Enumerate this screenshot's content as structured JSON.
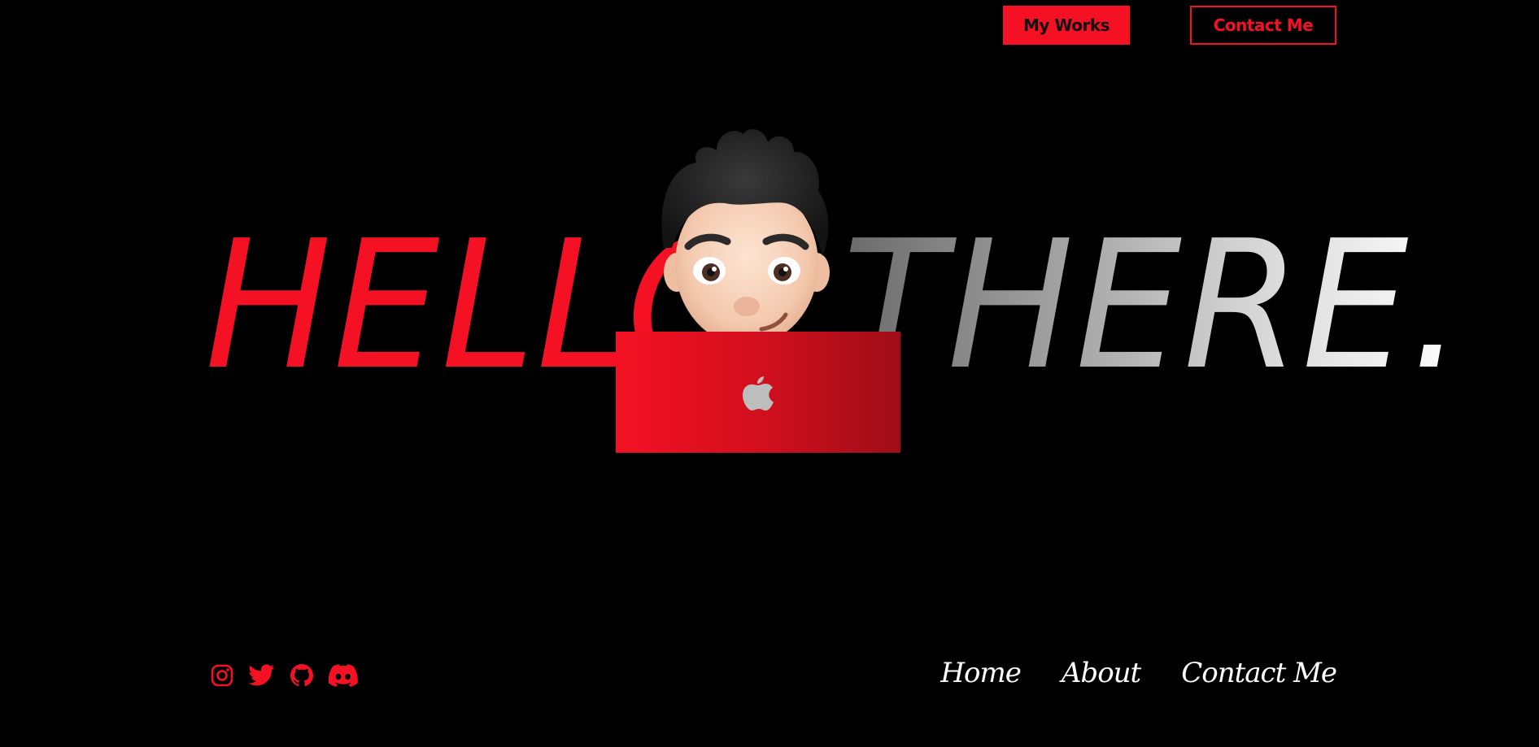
{
  "header": {
    "my_works_label": "My Works",
    "contact_label": "Contact Me"
  },
  "hero": {
    "word_left": "HELLO",
    "word_right": "THERE."
  },
  "laptop": {
    "logo_icon": "apple-logo-icon"
  },
  "social": {
    "icons": [
      "instagram-icon",
      "twitter-icon",
      "github-icon",
      "discord-icon"
    ]
  },
  "nav": {
    "items": [
      {
        "label": "Home"
      },
      {
        "label": "About"
      },
      {
        "label": "Contact Me"
      }
    ]
  },
  "colors": {
    "accent": "#f41123",
    "background": "#000000",
    "text": "#ffffff"
  }
}
